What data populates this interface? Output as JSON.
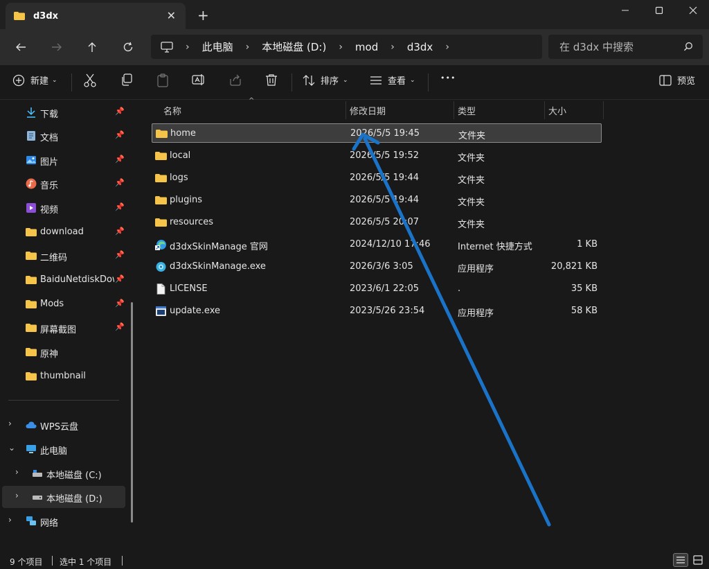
{
  "window": {
    "tab_title": "d3dx",
    "new_tab_symbol": "+",
    "close_tab_symbol": "✕"
  },
  "address": {
    "crumbs": [
      "此电脑",
      "本地磁盘 (D:)",
      "mod",
      "d3dx"
    ]
  },
  "search": {
    "placeholder": "在 d3dx 中搜索"
  },
  "toolbar": {
    "new_label": "新建",
    "sort_label": "排序",
    "view_label": "查看",
    "more_label": "•••",
    "preview_label": "预览"
  },
  "sidebar": {
    "quick_access": [
      {
        "label": "下载",
        "icon": "download-icon"
      },
      {
        "label": "文档",
        "icon": "document-icon"
      },
      {
        "label": "图片",
        "icon": "picture-icon"
      },
      {
        "label": "音乐",
        "icon": "music-icon"
      },
      {
        "label": "视频",
        "icon": "video-icon"
      },
      {
        "label": "download",
        "icon": "folder-icon"
      },
      {
        "label": "二维码",
        "icon": "folder-icon"
      },
      {
        "label": "BaiduNetdiskDownload",
        "icon": "folder-icon"
      },
      {
        "label": "Mods",
        "icon": "folder-icon"
      },
      {
        "label": "屏幕截图",
        "icon": "folder-icon"
      },
      {
        "label": "原神",
        "icon": "folder-icon"
      },
      {
        "label": "thumbnail",
        "icon": "folder-icon"
      }
    ],
    "tree": [
      {
        "label": "WPS云盘",
        "icon": "cloud-icon",
        "chevron": "›"
      },
      {
        "label": "此电脑",
        "icon": "computer-icon",
        "chevron": "⌄"
      },
      {
        "label": "本地磁盘 (C:)",
        "icon": "drive-icon",
        "chevron": "›"
      },
      {
        "label": "本地磁盘 (D:)",
        "icon": "drive-icon",
        "chevron": "›"
      },
      {
        "label": "网络",
        "icon": "network-icon",
        "chevron": "›"
      }
    ]
  },
  "columns": {
    "name": "名称",
    "date": "修改日期",
    "type": "类型",
    "size": "大小"
  },
  "files": [
    {
      "name": "home",
      "date": "2026/5/5 19:45",
      "type": "文件夹",
      "size": "",
      "icon": "folder-icon"
    },
    {
      "name": "local",
      "date": "2026/5/5 19:52",
      "type": "文件夹",
      "size": "",
      "icon": "folder-icon"
    },
    {
      "name": "logs",
      "date": "2026/5/5 19:44",
      "type": "文件夹",
      "size": "",
      "icon": "folder-icon"
    },
    {
      "name": "plugins",
      "date": "2026/5/5 19:44",
      "type": "文件夹",
      "size": "",
      "icon": "folder-icon"
    },
    {
      "name": "resources",
      "date": "2026/5/5 20:07",
      "type": "文件夹",
      "size": "",
      "icon": "folder-icon"
    },
    {
      "name": "d3dxSkinManage 官网",
      "date": "2024/12/10 17:46",
      "type": "Internet 快捷方式",
      "size": "1 KB",
      "icon": "edge-shortcut-icon"
    },
    {
      "name": "d3dxSkinManage.exe",
      "date": "2026/3/6 3:05",
      "type": "应用程序",
      "size": "20,821 KB",
      "icon": "app-icon"
    },
    {
      "name": "LICENSE",
      "date": "2023/6/1 22:05",
      "type": ".",
      "size": "35 KB",
      "icon": "file-icon"
    },
    {
      "name": "update.exe",
      "date": "2023/5/26 23:54",
      "type": "应用程序",
      "size": "58 KB",
      "icon": "exe-icon"
    }
  ],
  "status": {
    "item_count": "9 个项目",
    "selected": "选中 1 个项目"
  },
  "colors": {
    "folder": "#f7c44a",
    "arrow": "#1a73c7",
    "selection": "#3d3d3d"
  }
}
